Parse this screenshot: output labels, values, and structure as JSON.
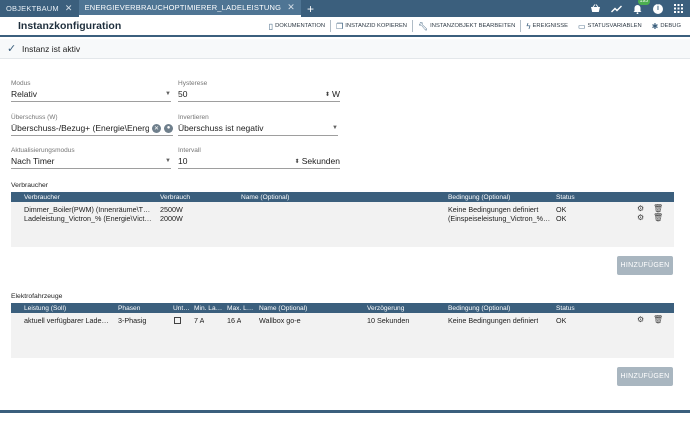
{
  "tabs": [
    {
      "label": "OBJEKTBAUM",
      "close": "✕"
    },
    {
      "label": "ENERGIEVERBRAUCHOPTIMIERER_LADELEISTUNG",
      "close": "✕"
    }
  ],
  "tab_add": "+",
  "notification_badge": "195",
  "title": "Instanzkonfiguration",
  "toolbar": {
    "dokumentation": "DOKUMENTATION",
    "instanzid_kopieren": "INSTANZID KOPIEREN",
    "instanzobjekt_bearbeiten": "INSTANZOBJEKT BEARBEITEN",
    "ereignisse": "EREIGNISSE",
    "statusvariablen": "STATUSVARIABLEN",
    "debug": "DEBUG"
  },
  "active_label": "Instanz ist aktiv",
  "form": {
    "modus": {
      "label": "Modus",
      "value": "Relativ"
    },
    "hysterese": {
      "label": "Hysterese",
      "value": "50",
      "unit": "W"
    },
    "ueberschuss": {
      "label": "Überschuss (W)",
      "value": "Überschuss-/Bezug+ (Energie\\Energ"
    },
    "invertieren": {
      "label": "Invertieren",
      "value": "Überschuss ist negativ"
    },
    "aktualisierungsmodus": {
      "label": "Aktualisierungsmodus",
      "value": "Nach Timer"
    },
    "intervall": {
      "label": "Intervall",
      "value": "10",
      "unit": "Sekunden"
    }
  },
  "verbraucher": {
    "section_label": "Verbraucher",
    "headers": [
      "Verbraucher",
      "Verbrauch",
      "Name (Optional)",
      "Bedingung (Optional)",
      "Status"
    ],
    "rows": [
      {
        "verbraucher": "Dimmer_Boiler(PWM) (Innenräume\\T…",
        "verbrauch": "2500W",
        "name": "",
        "bedingung": "Keine Bedingungen definiert",
        "status": "OK"
      },
      {
        "verbraucher": "Ladeleistung_Victron_% (Energie\\Vict…",
        "verbrauch": "2000W",
        "name": "",
        "bedingung": "(Einspeiseleistung_Victron_%…",
        "status": "OK"
      }
    ],
    "add_label": "HINZUFÜGEN"
  },
  "elektrofahrzeuge": {
    "section_label": "Elektrofahrzeuge",
    "headers": [
      "Leistung (Soll)",
      "Phasen",
      "Unt…",
      "Min. La…",
      "Max. L…",
      "Name (Optional)",
      "Verzögerung",
      "Bedingung (Optional)",
      "Status"
    ],
    "rows": [
      {
        "leistung": "aktuell verfügbarer Lade…",
        "phasen": "3-Phasig",
        "min": "7 A",
        "max": "16 A",
        "name": "Wallbox go-e",
        "verzoegerung": "10 Sekunden",
        "bedingung": "Keine Bedingungen definiert",
        "status": "OK"
      }
    ],
    "add_label": "HINZUFÜGEN"
  },
  "colors": {
    "primary": "#3b5f7d",
    "button_disabled": "#a9b6c0",
    "table_body": "#f2f2f2"
  },
  "icons": [
    "close-icon",
    "add-icon",
    "basket-icon",
    "chart-icon",
    "bell-icon",
    "info-icon",
    "apps-icon",
    "book-icon",
    "copy-icon",
    "wrench-icon",
    "flash-icon",
    "variable-icon",
    "bug-icon",
    "check-icon",
    "clear-icon",
    "user-icon",
    "gear-icon",
    "trash-icon"
  ]
}
